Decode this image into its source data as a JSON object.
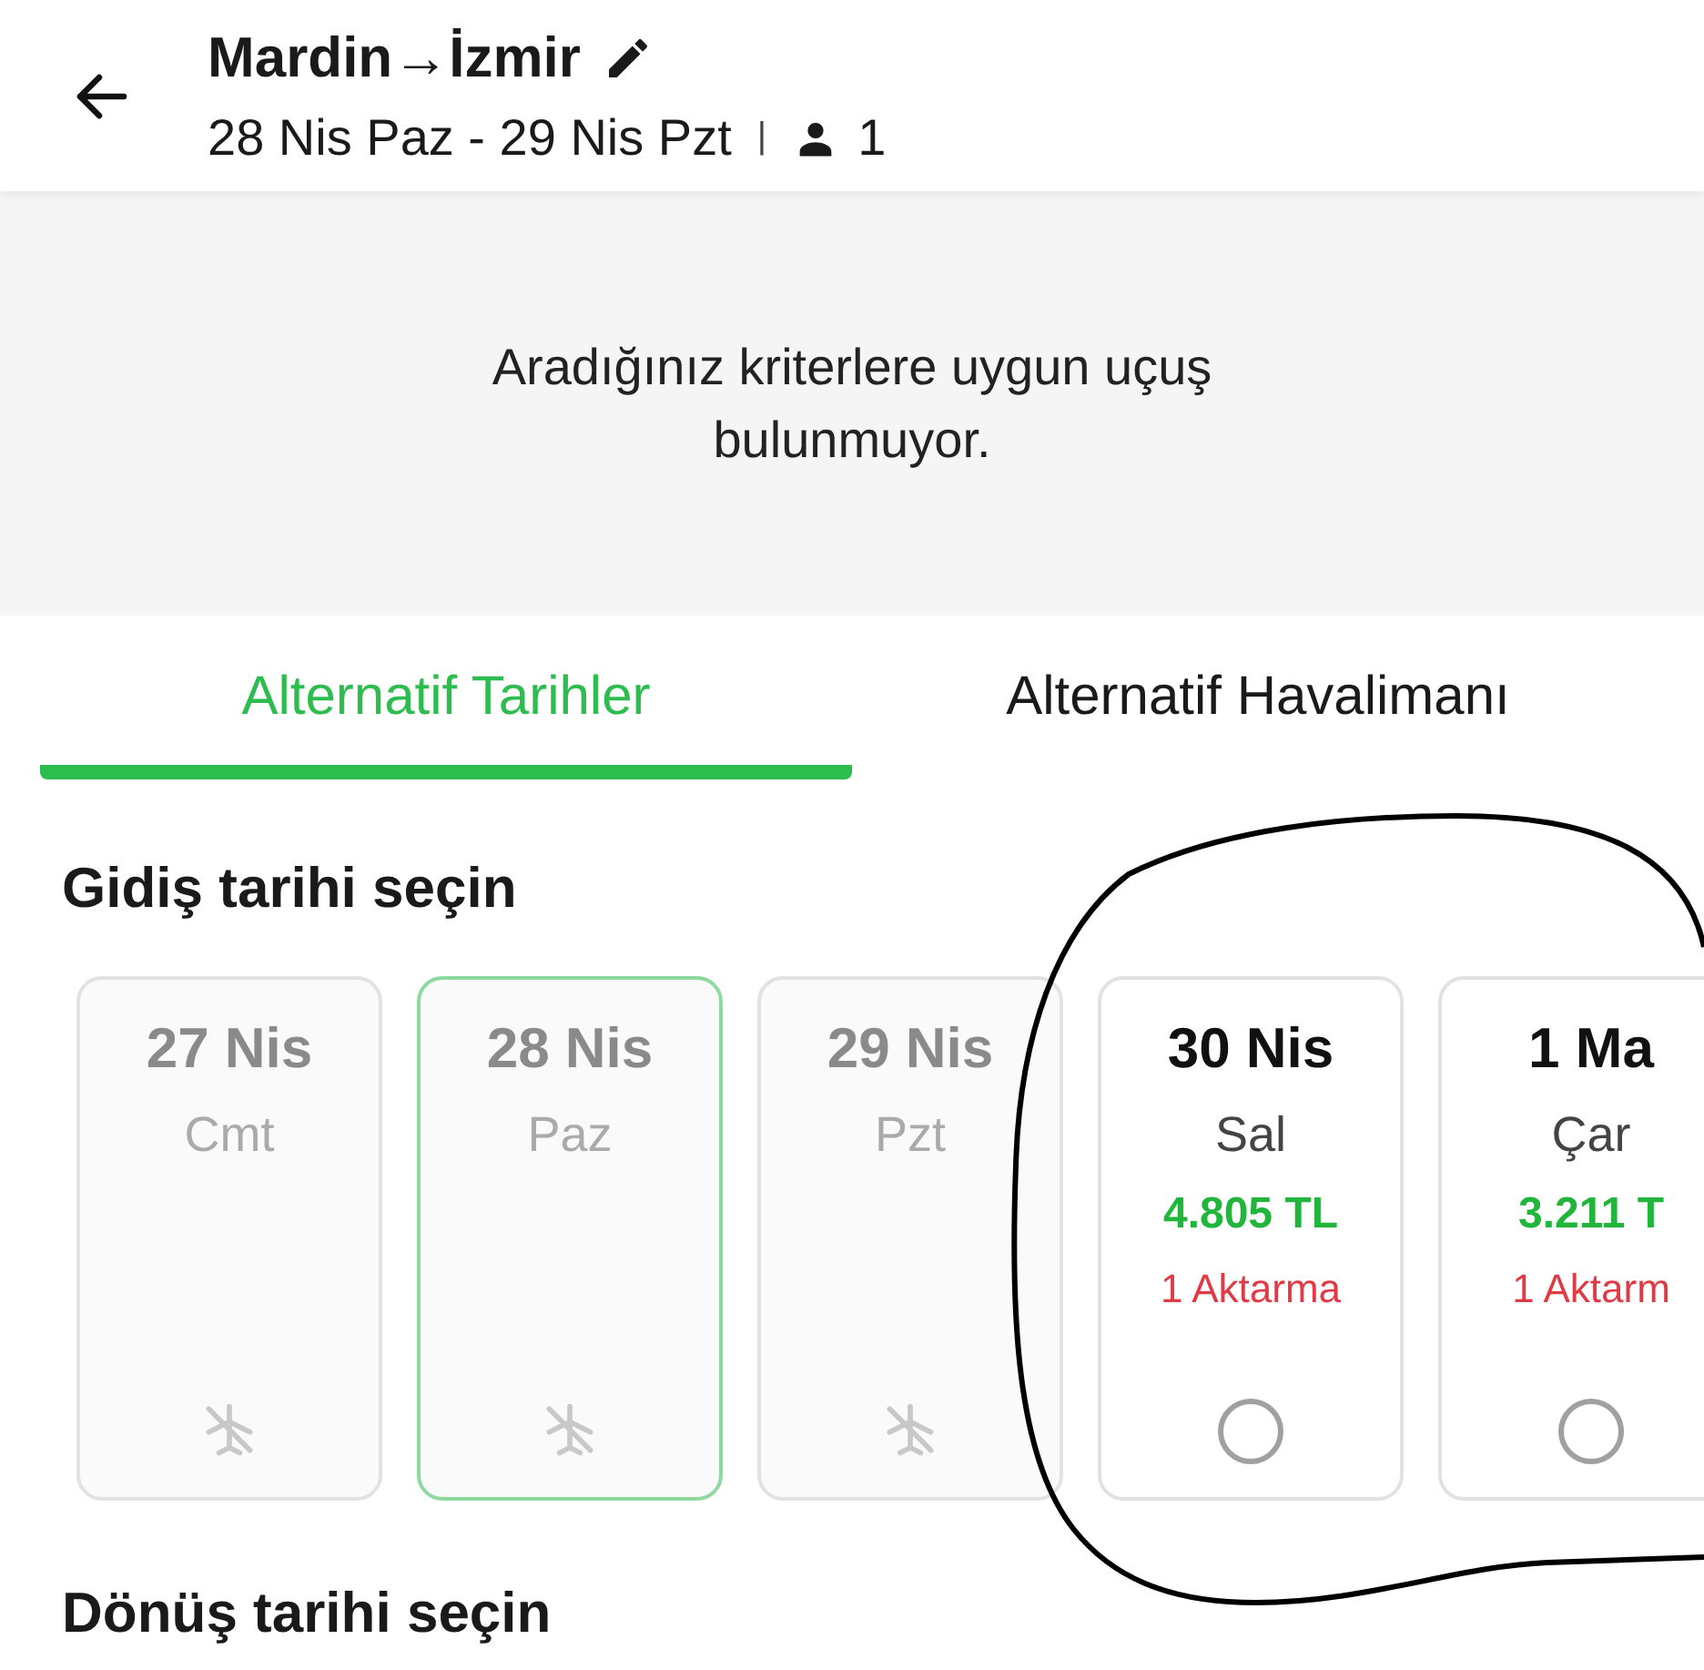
{
  "header": {
    "title": "Mardin→İzmir",
    "dates": "28 Nis Paz - 29 Nis Pzt",
    "separator": "|",
    "passengers": "1"
  },
  "message": "Aradığınız kriterlere uygun uçuş bulunmuyor.",
  "tabs": [
    {
      "label": "Alternatif Tarihler",
      "selected": true
    },
    {
      "label": "Alternatif Havalimanı",
      "selected": false
    }
  ],
  "departure": {
    "title": "Gidiş tarihi seçin",
    "cards": [
      {
        "kind": "unavailable",
        "date": "27 Nis",
        "day": "Cmt",
        "selected": false
      },
      {
        "kind": "unavailable",
        "date": "28 Nis",
        "day": "Paz",
        "selected": true
      },
      {
        "kind": "unavailable",
        "date": "29 Nis",
        "day": "Pzt",
        "selected": false
      },
      {
        "kind": "available",
        "date": "30 Nis",
        "day": "Sal",
        "price": "4.805 TL",
        "stops": "1 Aktarma",
        "selected": false
      },
      {
        "kind": "available",
        "date": "1 Ma",
        "day": "Çar",
        "price": "3.211 T",
        "stops": "1 Aktarm",
        "selected": false
      }
    ]
  },
  "return": {
    "title": "Dönüş tarihi seçin"
  }
}
